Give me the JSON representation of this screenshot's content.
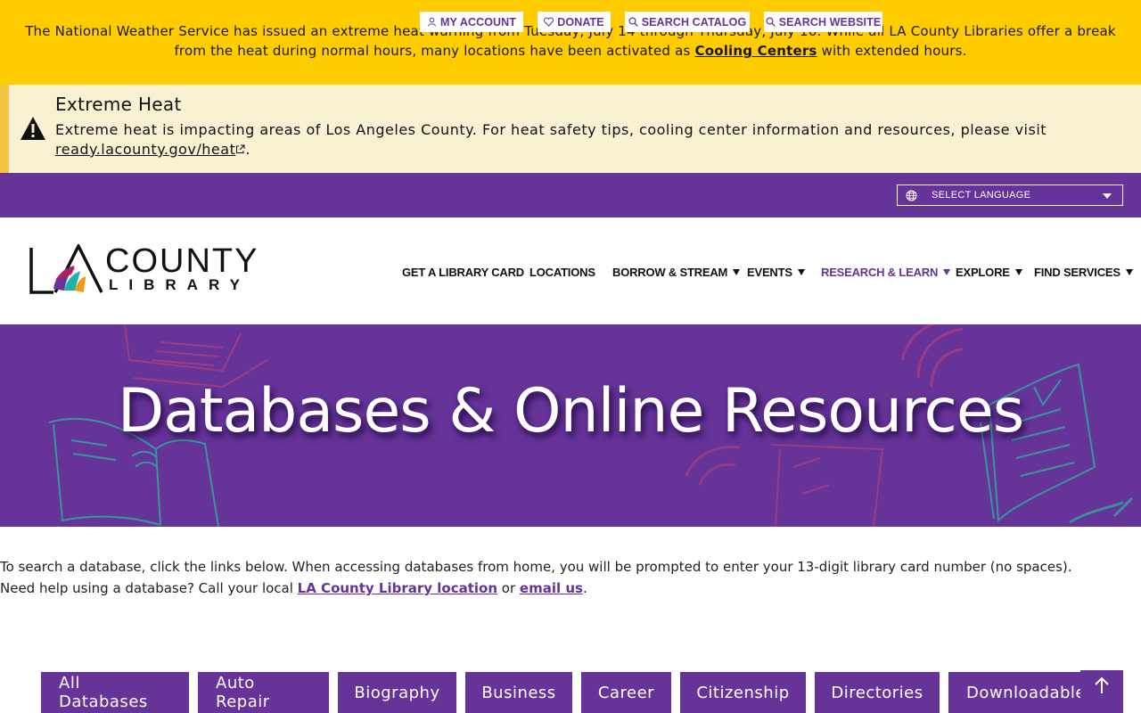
{
  "heat_warning": {
    "text_before": "The National Weather Service has issued an extreme heat warning from Tuesday, July 14 through Thursday, July 16. While all LA County Libraries offer a break from the heat during normal hours, many locations have been activated as ",
    "link": "Cooling Centers",
    "text_after": " with extended hours."
  },
  "alert": {
    "title": "Extreme Heat",
    "body": "Extreme heat is impacting areas of Los Angeles County. For heat safety tips, cooling center information and resources, please visit ",
    "link": "ready.lacounty.gov/heat",
    "end": "."
  },
  "utility": {
    "my_account": "MY ACCOUNT",
    "donate": "DONATE",
    "search_catalog": "SEARCH CATALOG",
    "search_website": "SEARCH WEBSITE",
    "language": "SELECT LANGUAGE"
  },
  "logo": {
    "line1": "COUNTY",
    "line2": "LIBRARY"
  },
  "nav": [
    {
      "label": "GET A LIBRARY CARD"
    },
    {
      "label": "LOCATIONS"
    },
    {
      "label": "BORROW & STREAM"
    },
    {
      "label": "EVENTS"
    },
    {
      "label": "RESEARCH & LEARN"
    },
    {
      "label": "EXPLORE"
    },
    {
      "label": "FIND SERVICES"
    }
  ],
  "hero": {
    "title": "Databases & Online Resources"
  },
  "intro": {
    "line1": "To search a database, click the links below. When accessing databases from home, you will be prompted to enter your 13-digit library card number (no spaces).",
    "line2_before": "Need help using a database? Call your local ",
    "line2_link1": "LA County Library location",
    "line2_mid": " or ",
    "line2_link2": "email us",
    "line2_end": "."
  },
  "categories": [
    "All Databases",
    "Auto Repair",
    "Biography",
    "Business",
    "Career",
    "Citizenship",
    "Directories",
    "Downloadable"
  ],
  "colors": {
    "brand_purple": "#663399",
    "warning_yellow": "#ffcc00",
    "alert_bg": "#f8f1d2"
  }
}
